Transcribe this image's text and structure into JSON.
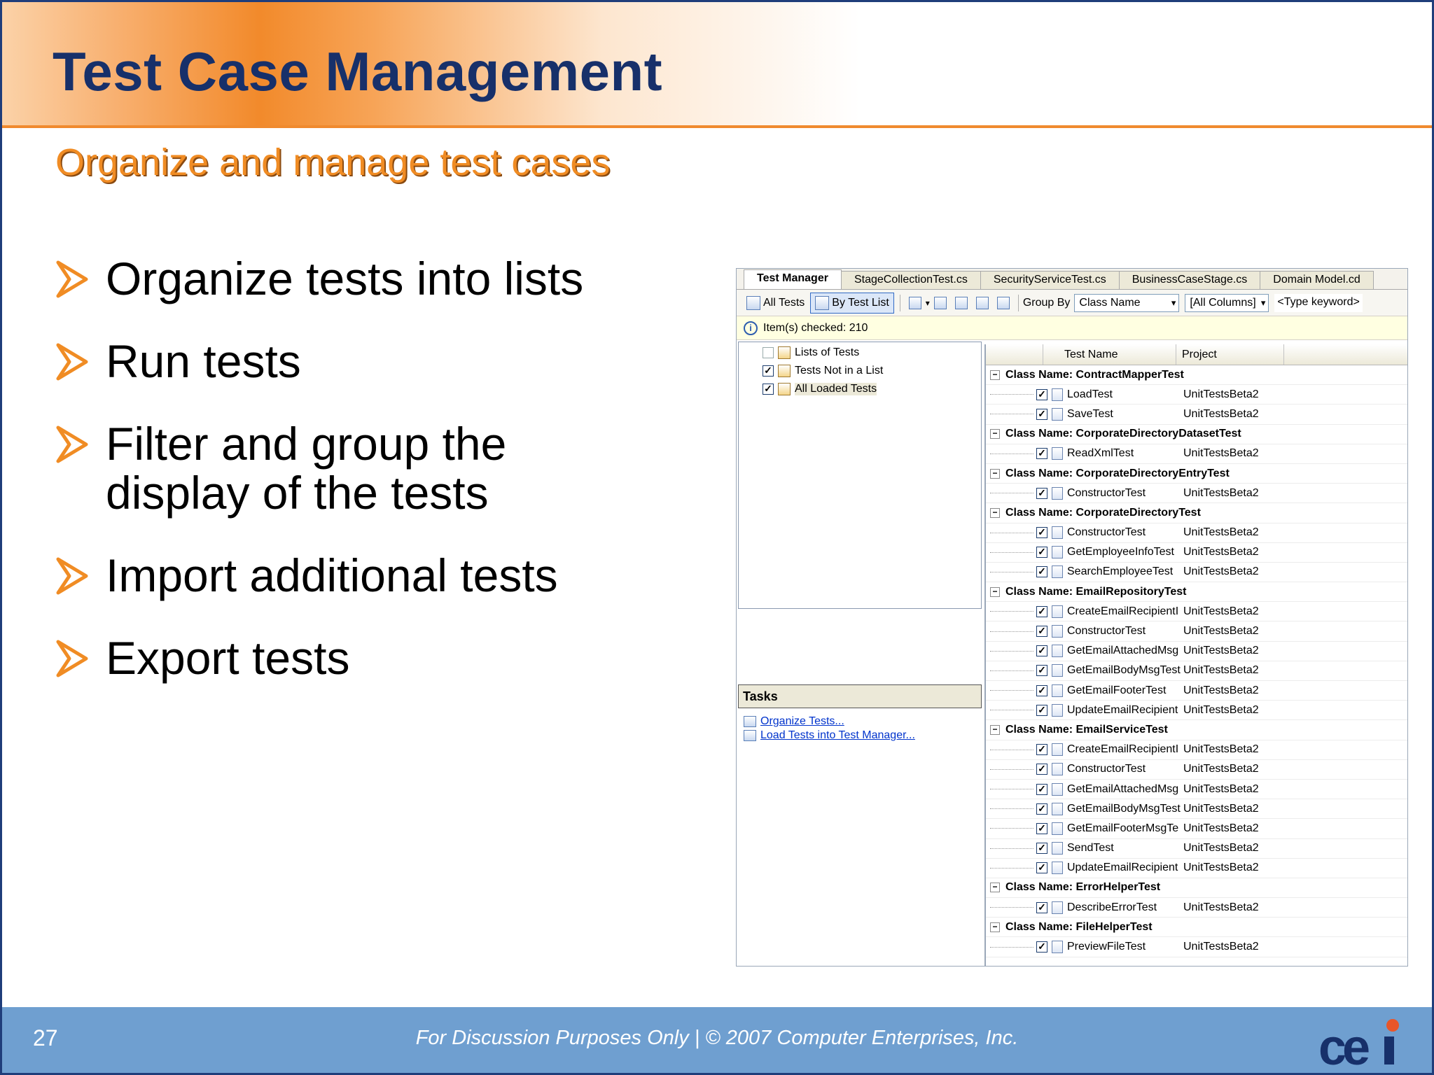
{
  "slide": {
    "title": "Test Case Management",
    "subtitle": "Organize and manage test cases",
    "bullets": [
      "Organize tests into lists",
      "Run tests",
      "Filter and group the display of the tests",
      "Import additional tests",
      "Export tests"
    ],
    "page_number": "27",
    "footer_text": "For Discussion Purposes Only  |  © 2007 Computer Enterprises, Inc.",
    "logo_text": "cei",
    "colors": {
      "title": "#17306a",
      "accent": "#f08c24",
      "footer": "#6f9fd0",
      "arrow": "#f08c24"
    }
  },
  "vs": {
    "tabs": [
      "Test Manager",
      "StageCollectionTest.cs",
      "SecurityServiceTest.cs",
      "BusinessCaseStage.cs",
      "Domain Model.cd"
    ],
    "toolbar": {
      "all_tests": "All Tests",
      "by_test_list": "By Test List",
      "group_by_label": "Group By",
      "group_by_value": "Class Name",
      "columns_value": "[All Columns]",
      "keyword_placeholder": "<Type keyword>"
    },
    "info": "Item(s) checked: 210",
    "tree": [
      {
        "label": "Lists of Tests",
        "checked": false
      },
      {
        "label": "Tests Not in a List",
        "checked": true
      },
      {
        "label": "All Loaded Tests",
        "checked": true
      }
    ],
    "tasks_title": "Tasks",
    "tasks": [
      "Organize Tests...",
      "Load Tests into Test Manager..."
    ],
    "grid_headers": [
      "Test Name",
      "Project"
    ],
    "groups": [
      {
        "name": "Class Name: ContractMapperTest",
        "tests": [
          [
            "LoadTest",
            "UnitTestsBeta2"
          ],
          [
            "SaveTest",
            "UnitTestsBeta2"
          ]
        ]
      },
      {
        "name": "Class Name: CorporateDirectoryDatasetTest",
        "tests": [
          [
            "ReadXmlTest",
            "UnitTestsBeta2"
          ]
        ]
      },
      {
        "name": "Class Name: CorporateDirectoryEntryTest",
        "tests": [
          [
            "ConstructorTest",
            "UnitTestsBeta2"
          ]
        ]
      },
      {
        "name": "Class Name: CorporateDirectoryTest",
        "tests": [
          [
            "ConstructorTest",
            "UnitTestsBeta2"
          ],
          [
            "GetEmployeeInfoTest",
            "UnitTestsBeta2"
          ],
          [
            "SearchEmployeeTest",
            "UnitTestsBeta2"
          ]
        ]
      },
      {
        "name": "Class Name: EmailRepositoryTest",
        "tests": [
          [
            "CreateEmailRecipientI",
            "UnitTestsBeta2"
          ],
          [
            "ConstructorTest",
            "UnitTestsBeta2"
          ],
          [
            "GetEmailAttachedMsg",
            "UnitTestsBeta2"
          ],
          [
            "GetEmailBodyMsgTest",
            "UnitTestsBeta2"
          ],
          [
            "GetEmailFooterTest",
            "UnitTestsBeta2"
          ],
          [
            "UpdateEmailRecipient",
            "UnitTestsBeta2"
          ]
        ]
      },
      {
        "name": "Class Name: EmailServiceTest",
        "tests": [
          [
            "CreateEmailRecipientI",
            "UnitTestsBeta2"
          ],
          [
            "ConstructorTest",
            "UnitTestsBeta2"
          ],
          [
            "GetEmailAttachedMsg",
            "UnitTestsBeta2"
          ],
          [
            "GetEmailBodyMsgTest",
            "UnitTestsBeta2"
          ],
          [
            "GetEmailFooterMsgTe",
            "UnitTestsBeta2"
          ],
          [
            "SendTest",
            "UnitTestsBeta2"
          ],
          [
            "UpdateEmailRecipient",
            "UnitTestsBeta2"
          ]
        ]
      },
      {
        "name": "Class Name: ErrorHelperTest",
        "tests": [
          [
            "DescribeErrorTest",
            "UnitTestsBeta2"
          ]
        ]
      },
      {
        "name": "Class Name: FileHelperTest",
        "tests": [
          [
            "PreviewFileTest",
            "UnitTestsBeta2"
          ]
        ]
      }
    ]
  }
}
